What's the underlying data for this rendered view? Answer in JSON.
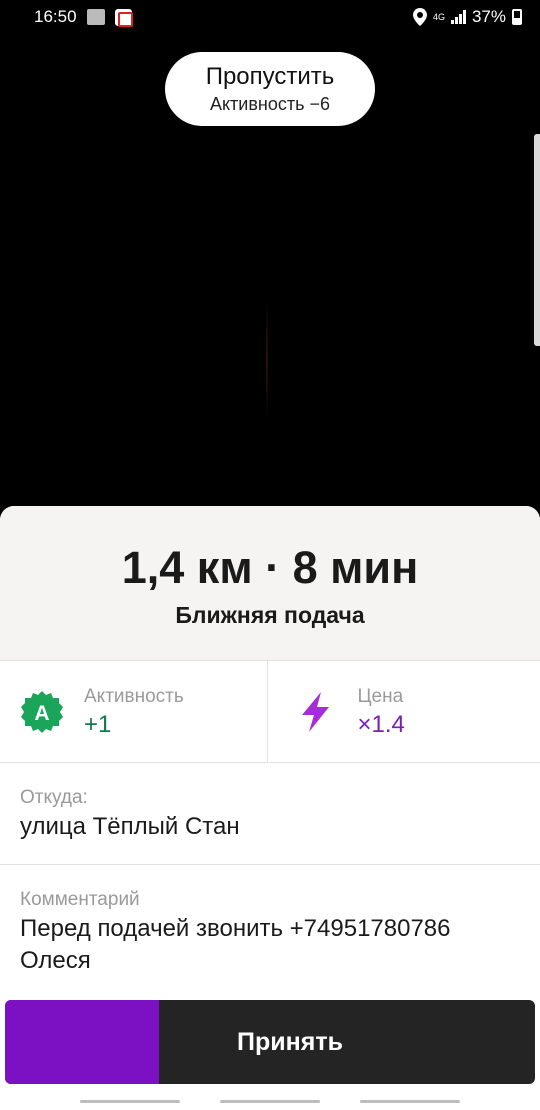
{
  "status_bar": {
    "time": "16:50",
    "network": "4G",
    "battery": "37%"
  },
  "skip": {
    "title": "Пропустить",
    "subtitle": "Активность −6"
  },
  "order": {
    "distance_time": "1,4 км · 8 мин",
    "pickup_type": "Ближняя подача"
  },
  "stats": {
    "activity": {
      "label": "Активность",
      "value": "+1",
      "icon_letter": "A"
    },
    "price": {
      "label": "Цена",
      "value": "×1.4"
    }
  },
  "from": {
    "label": "Откуда:",
    "value": "улица Тёплый Стан"
  },
  "comment": {
    "label": "Комментарий",
    "line1": "Перед подачей звонить +74951780786",
    "line2": "Олеся"
  },
  "accept": {
    "label": "Принять",
    "progress_fraction": 0.29
  },
  "colors": {
    "accent_purple": "#7b11c2",
    "activity_green": "#1aa55a",
    "price_purple": "#a52fd6"
  },
  "icons": {
    "activity": "activity-badge-icon",
    "price": "lightning-icon",
    "location": "location-pin-icon",
    "battery": "battery-icon",
    "signal": "signal-icon"
  }
}
